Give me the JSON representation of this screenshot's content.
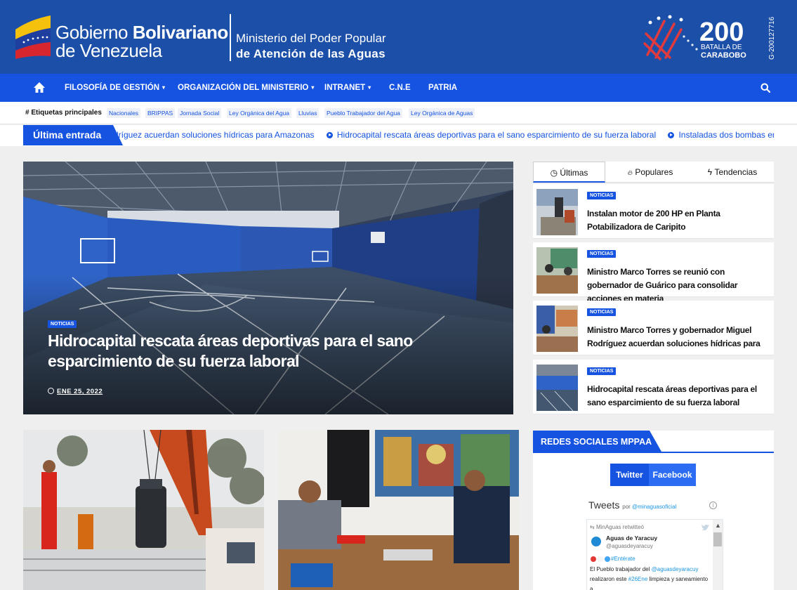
{
  "header": {
    "gov_line1_light": "Gobierno ",
    "gov_line1_bold": "Bolivariano",
    "gov_line2": "de Venezuela",
    "ministry_line1": "Ministerio del  Poder Popular",
    "ministry_line2": "de Atención de las Aguas",
    "bicentennial_number": "200",
    "bicentennial_line1": "BATALLA DE",
    "bicentennial_line2": "CARABOBO",
    "rif": "G-200127716"
  },
  "nav": {
    "home_icon": "home-icon",
    "items": [
      {
        "label": "FILOSOFÍA DE GESTIÓN",
        "caret": "▾"
      },
      {
        "label": "ORGANIZACIÓN DEL MINISTERIO",
        "caret": "▾"
      },
      {
        "label": "INTRANET",
        "caret": "▾"
      },
      {
        "label": "C.N.E",
        "caret": ""
      },
      {
        "label": "PATRIA",
        "caret": ""
      }
    ],
    "search_icon": "search-icon"
  },
  "tags": {
    "title": "Etiquetas principales",
    "items": [
      "Nacionales",
      "BRIPPAS",
      "Jornada Social",
      "Ley Orgánica del Agua",
      "Lluvias",
      "Pueblo Trabajador del Agua",
      "Ley Orgánica de Aguas"
    ]
  },
  "ticker": {
    "label": "Última entrada",
    "items": [
      "dríguez acuerdan soluciones hídricas para Amazonas",
      "Hidrocapital rescata áreas deportivas para el sano esparcimiento de su fuerza laboral",
      "Instaladas dos bombas en p"
    ]
  },
  "hero": {
    "badge": "NOTICIAS",
    "title": "Hidrocapital rescata áreas deportivas para el sano esparcimiento de su fuerza laboral",
    "date": "ENE 25, 2022"
  },
  "sidebar_tabs": [
    {
      "label": "Últimas",
      "icon": "clock-icon"
    },
    {
      "label": "Populares",
      "icon": "torch-icon"
    },
    {
      "label": "Tendencias",
      "icon": "bolt-icon"
    }
  ],
  "sidebar_posts": [
    {
      "badge": "NOTICIAS",
      "title": "Instalan motor de 200 HP en Planta Potabilizadora de Caripito"
    },
    {
      "badge": "NOTICIAS",
      "title": "Ministro Marco Torres se reunió con gobernador de Guárico para consolidar acciones en materia"
    },
    {
      "badge": "NOTICIAS",
      "title": "Ministro Marco Torres y gobernador Miguel Rodríguez acuerdan soluciones hídricas para"
    },
    {
      "badge": "NOTICIAS",
      "title": "Hidrocapital rescata áreas deportivas para el sano esparcimiento de su fuerza laboral"
    }
  ],
  "social": {
    "title": "REDES SOCIALES MPPAA",
    "tab_twitter": "Twitter",
    "tab_facebook": "Facebook",
    "tweets_title": "Tweets",
    "tweets_by": "por ",
    "tweets_handle": "@minaguasoficial",
    "info": "i",
    "retweet": "MinAguas retwitteó",
    "tweet_name": "Aguas de Yaracuy",
    "tweet_handle": "@aguasdeyaracuy",
    "tweet_hashtag": "#Entérate",
    "tweet_body_1": "El Pueblo trabajador del ",
    "tweet_body_mention": "@aguasdeyaracuy",
    "tweet_body_2": "realizaron este ",
    "tweet_body_tag": "#26Ene",
    "tweet_body_3": " limpieza y saneamiento a",
    "scroll_up": "▲"
  },
  "colors": {
    "header_bg": "#1c4fa8",
    "nav_bg": "#1553e0",
    "accent": "#1553e0"
  }
}
